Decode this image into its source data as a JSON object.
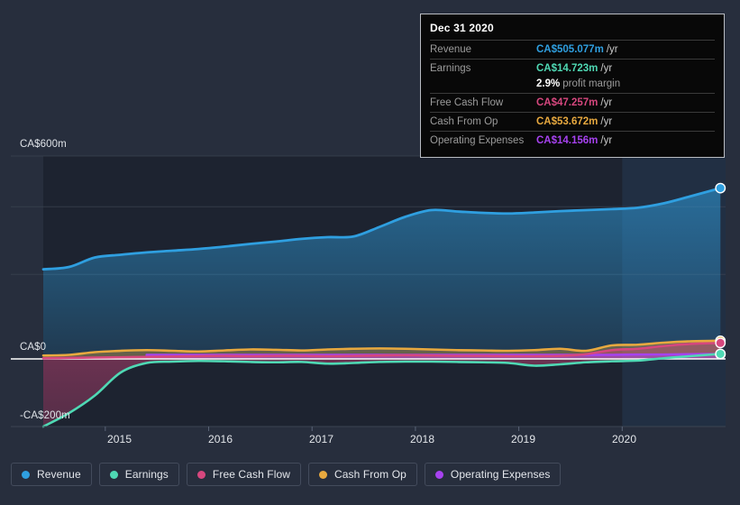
{
  "colors": {
    "background": "#272e3d",
    "plot_background": "#1d2330",
    "highlight_band": "#223147",
    "gridline": "#3c4452",
    "zero_line": "#ffffff",
    "revenue": "#2f9fe0",
    "earnings": "#4fd9b4",
    "free_cash_flow": "#d6477e",
    "cash_from_op": "#e8a93f",
    "operating_expenses": "#a742f0",
    "tooltip_bg": "#080808",
    "tooltip_border": "#b9bcc2",
    "tooltip_label": "#9b9b9b"
  },
  "tooltip": {
    "title": "Dec 31 2020",
    "rows": [
      {
        "label": "Revenue",
        "value": "CA$505.077m",
        "unit": "/yr",
        "color_key": "revenue"
      },
      {
        "label": "Earnings",
        "value": "CA$14.723m",
        "unit": "/yr",
        "color_key": "earnings"
      },
      {
        "label": "",
        "value": "2.9%",
        "unit": "profit margin",
        "color_key": "white",
        "sub": true
      },
      {
        "label": "Free Cash Flow",
        "value": "CA$47.257m",
        "unit": "/yr",
        "color_key": "free_cash_flow"
      },
      {
        "label": "Cash From Op",
        "value": "CA$53.672m",
        "unit": "/yr",
        "color_key": "cash_from_op"
      },
      {
        "label": "Operating Expenses",
        "value": "CA$14.156m",
        "unit": "/yr",
        "color_key": "operating_expenses"
      }
    ]
  },
  "legend": {
    "items": [
      {
        "label": "Revenue",
        "color_key": "revenue"
      },
      {
        "label": "Earnings",
        "color_key": "earnings"
      },
      {
        "label": "Free Cash Flow",
        "color_key": "free_cash_flow"
      },
      {
        "label": "Cash From Op",
        "color_key": "cash_from_op"
      },
      {
        "label": "Operating Expenses",
        "color_key": "operating_expenses"
      }
    ]
  },
  "chart_data": {
    "type": "area",
    "title": "",
    "xlabel": "",
    "ylabel": "",
    "currency": "CA$",
    "units": "millions",
    "grid": true,
    "legend_position": "bottom",
    "ylim": [
      -200,
      600
    ],
    "y_ticks": [
      600,
      0,
      -200
    ],
    "y_tick_labels": [
      "CA$600m",
      "CA$0",
      "-CA$200m"
    ],
    "y_gridlines": [
      600,
      450,
      250,
      0,
      -200
    ],
    "xlim": [
      "2014.4",
      "2021.0"
    ],
    "x_ticks": [
      2015,
      2016,
      2017,
      2018,
      2019,
      2020
    ],
    "x_tick_labels": [
      "2015",
      "2016",
      "2017",
      "2018",
      "2019",
      "2020"
    ],
    "highlight_from": 2020.0,
    "highlight_to": 2021.0,
    "x": [
      2014.4,
      2014.65,
      2014.9,
      2015.15,
      2015.4,
      2015.65,
      2015.9,
      2016.15,
      2016.4,
      2016.65,
      2016.9,
      2017.15,
      2017.4,
      2017.65,
      2017.9,
      2018.15,
      2018.4,
      2018.65,
      2018.9,
      2019.15,
      2019.4,
      2019.65,
      2019.9,
      2020.15,
      2020.4,
      2020.65,
      2020.95
    ],
    "series": [
      {
        "name": "Revenue",
        "color_key": "revenue",
        "values": [
          265,
          272,
          300,
          308,
          315,
          320,
          325,
          332,
          340,
          347,
          355,
          360,
          362,
          390,
          420,
          440,
          436,
          432,
          430,
          433,
          437,
          440,
          443,
          447,
          460,
          480,
          505.077
        ]
      },
      {
        "name": "Earnings",
        "color_key": "earnings",
        "values": [
          -200,
          -160,
          -108,
          -40,
          -12,
          -8,
          -6,
          -7,
          -9,
          -10,
          -9,
          -14,
          -12,
          -9,
          -8,
          -8,
          -9,
          -10,
          -12,
          -20,
          -16,
          -10,
          -7,
          -5,
          2,
          8,
          14.723
        ]
      },
      {
        "name": "Free Cash Flow",
        "color_key": "free_cash_flow",
        "values": [
          2,
          3,
          4,
          5,
          6,
          7,
          8,
          9,
          8,
          9,
          9,
          8,
          9,
          10,
          11,
          10,
          9,
          9,
          8,
          8,
          9,
          14,
          26,
          30,
          38,
          44,
          47.257
        ]
      },
      {
        "name": "Cash From Op",
        "color_key": "cash_from_op",
        "values": [
          10,
          12,
          20,
          24,
          26,
          24,
          22,
          25,
          28,
          27,
          25,
          28,
          30,
          31,
          30,
          28,
          26,
          25,
          24,
          26,
          30,
          24,
          40,
          42,
          48,
          52,
          53.672
        ]
      },
      {
        "name": "Operating Expenses",
        "color_key": "operating_expenses",
        "values": [
          null,
          null,
          null,
          null,
          12,
          12,
          12,
          12,
          12,
          12,
          12,
          12,
          12,
          12,
          12,
          12,
          12,
          12,
          12,
          12,
          12,
          12,
          12,
          13,
          13,
          14,
          14.156
        ]
      }
    ],
    "endpoint_markers": [
      {
        "series": "Revenue",
        "value": 505.077
      },
      {
        "series": "Cash From Op",
        "value": 53.672
      },
      {
        "series": "Free Cash Flow",
        "value": 47.257
      },
      {
        "series": "Operating Expenses",
        "value": 14.156
      },
      {
        "series": "Earnings",
        "value": 14.723
      }
    ]
  }
}
